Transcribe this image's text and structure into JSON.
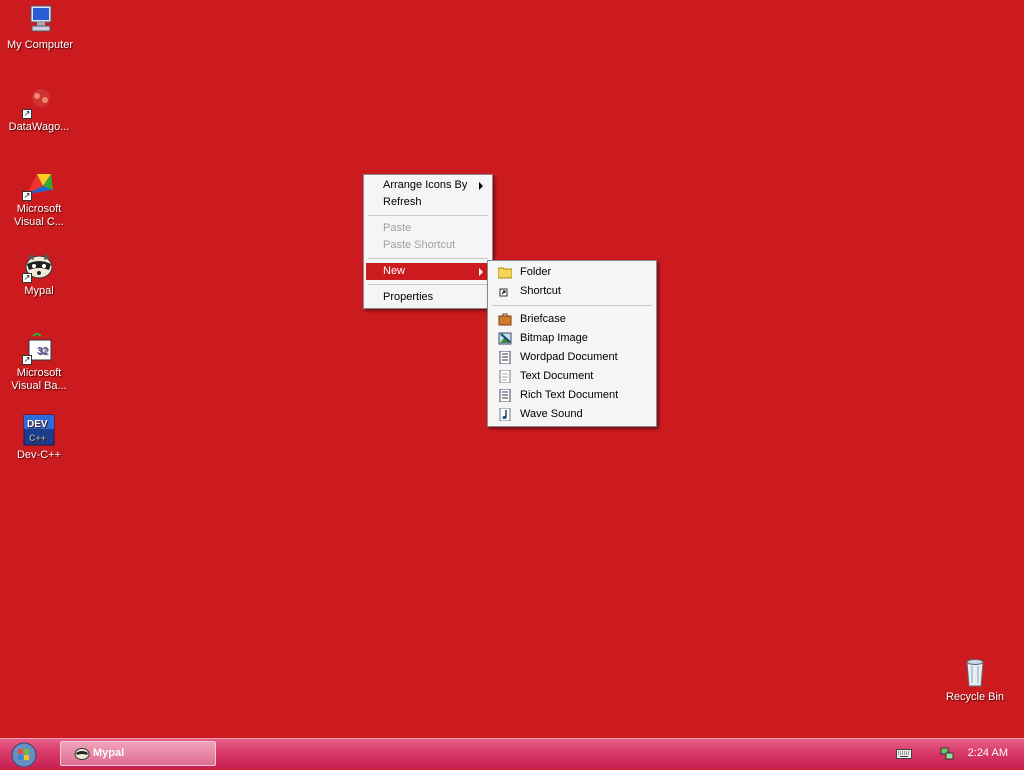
{
  "desktop": {
    "background": "#cc1b1f",
    "icons": [
      {
        "label": "My Computer",
        "icon": "computer-icon"
      },
      {
        "label": "DataWago...",
        "icon": "datawagon-icon"
      },
      {
        "label": "Microsoft Visual C...",
        "icon": "visual-cpp-icon"
      },
      {
        "label": "Mypal",
        "icon": "mypal-raccoon-icon"
      },
      {
        "label": "Microsoft Visual Ba...",
        "icon": "visual-basic-icon"
      },
      {
        "label": "Dev-C++",
        "icon": "devcpp-icon"
      },
      {
        "label": "Recycle Bin",
        "icon": "recycle-bin-icon"
      }
    ]
  },
  "context_menu": {
    "items": [
      {
        "label": "Arrange Icons By",
        "submenu": true
      },
      {
        "label": "Refresh"
      },
      {
        "label": "Paste",
        "disabled": true
      },
      {
        "label": "Paste Shortcut",
        "disabled": true
      },
      {
        "label": "New",
        "submenu": true,
        "active": true
      },
      {
        "label": "Properties"
      }
    ]
  },
  "new_submenu": {
    "items": [
      {
        "label": "Folder",
        "icon": "folder-icon"
      },
      {
        "label": "Shortcut",
        "icon": "shortcut-icon"
      },
      {
        "label": "Briefcase",
        "icon": "briefcase-icon"
      },
      {
        "label": "Bitmap Image",
        "icon": "bitmap-icon"
      },
      {
        "label": "Wordpad Document",
        "icon": "wordpad-icon"
      },
      {
        "label": "Text Document",
        "icon": "text-document-icon"
      },
      {
        "label": "Rich Text Document",
        "icon": "rich-text-icon"
      },
      {
        "label": "Wave Sound",
        "icon": "wave-sound-icon"
      }
    ]
  },
  "taskbar": {
    "task_button_label": "Mypal",
    "clock": "2:24 AM"
  }
}
